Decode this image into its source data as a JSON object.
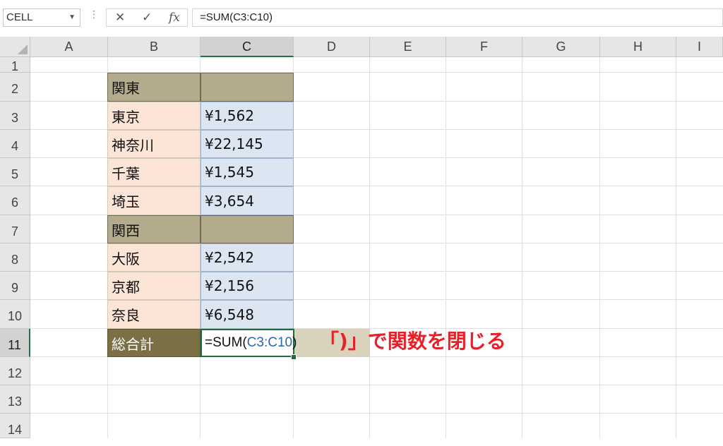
{
  "formula_bar": {
    "name_box": "CELL",
    "cancel_glyph": "✕",
    "enter_glyph": "✓",
    "fx_label": "fx",
    "formula": "=SUM(C3:C10)"
  },
  "columns": [
    "A",
    "B",
    "C",
    "D",
    "E",
    "F",
    "G",
    "H",
    "I"
  ],
  "rows": [
    "1",
    "2",
    "3",
    "4",
    "5",
    "6",
    "7",
    "8",
    "9",
    "10",
    "11",
    "12",
    "13",
    "14"
  ],
  "table": {
    "region_east": "関東",
    "region_west": "関西",
    "entries": [
      {
        "pref": "東京",
        "value": "¥1,562"
      },
      {
        "pref": "神奈川",
        "value": "¥22,145"
      },
      {
        "pref": "千葉",
        "value": "¥1,545"
      },
      {
        "pref": "埼玉",
        "value": "¥3,654"
      },
      {
        "pref": "大阪",
        "value": "¥2,542"
      },
      {
        "pref": "京都",
        "value": "¥2,156"
      },
      {
        "pref": "奈良",
        "value": "¥6,548"
      }
    ],
    "total_label": "総合計",
    "total_formula_prefix": "=SUM(",
    "total_formula_range": "C3:C10",
    "total_formula_suffix": ")"
  },
  "annotation": "「)」で関数を閉じる",
  "colors": {
    "region_fill": "#b4ab8c",
    "pref_fill": "#fce4d6",
    "value_fill": "#dce6f2",
    "total_fill": "#7b6f45",
    "annotation_text": "#e8202a",
    "range_ref_text": "#2e63b0"
  }
}
